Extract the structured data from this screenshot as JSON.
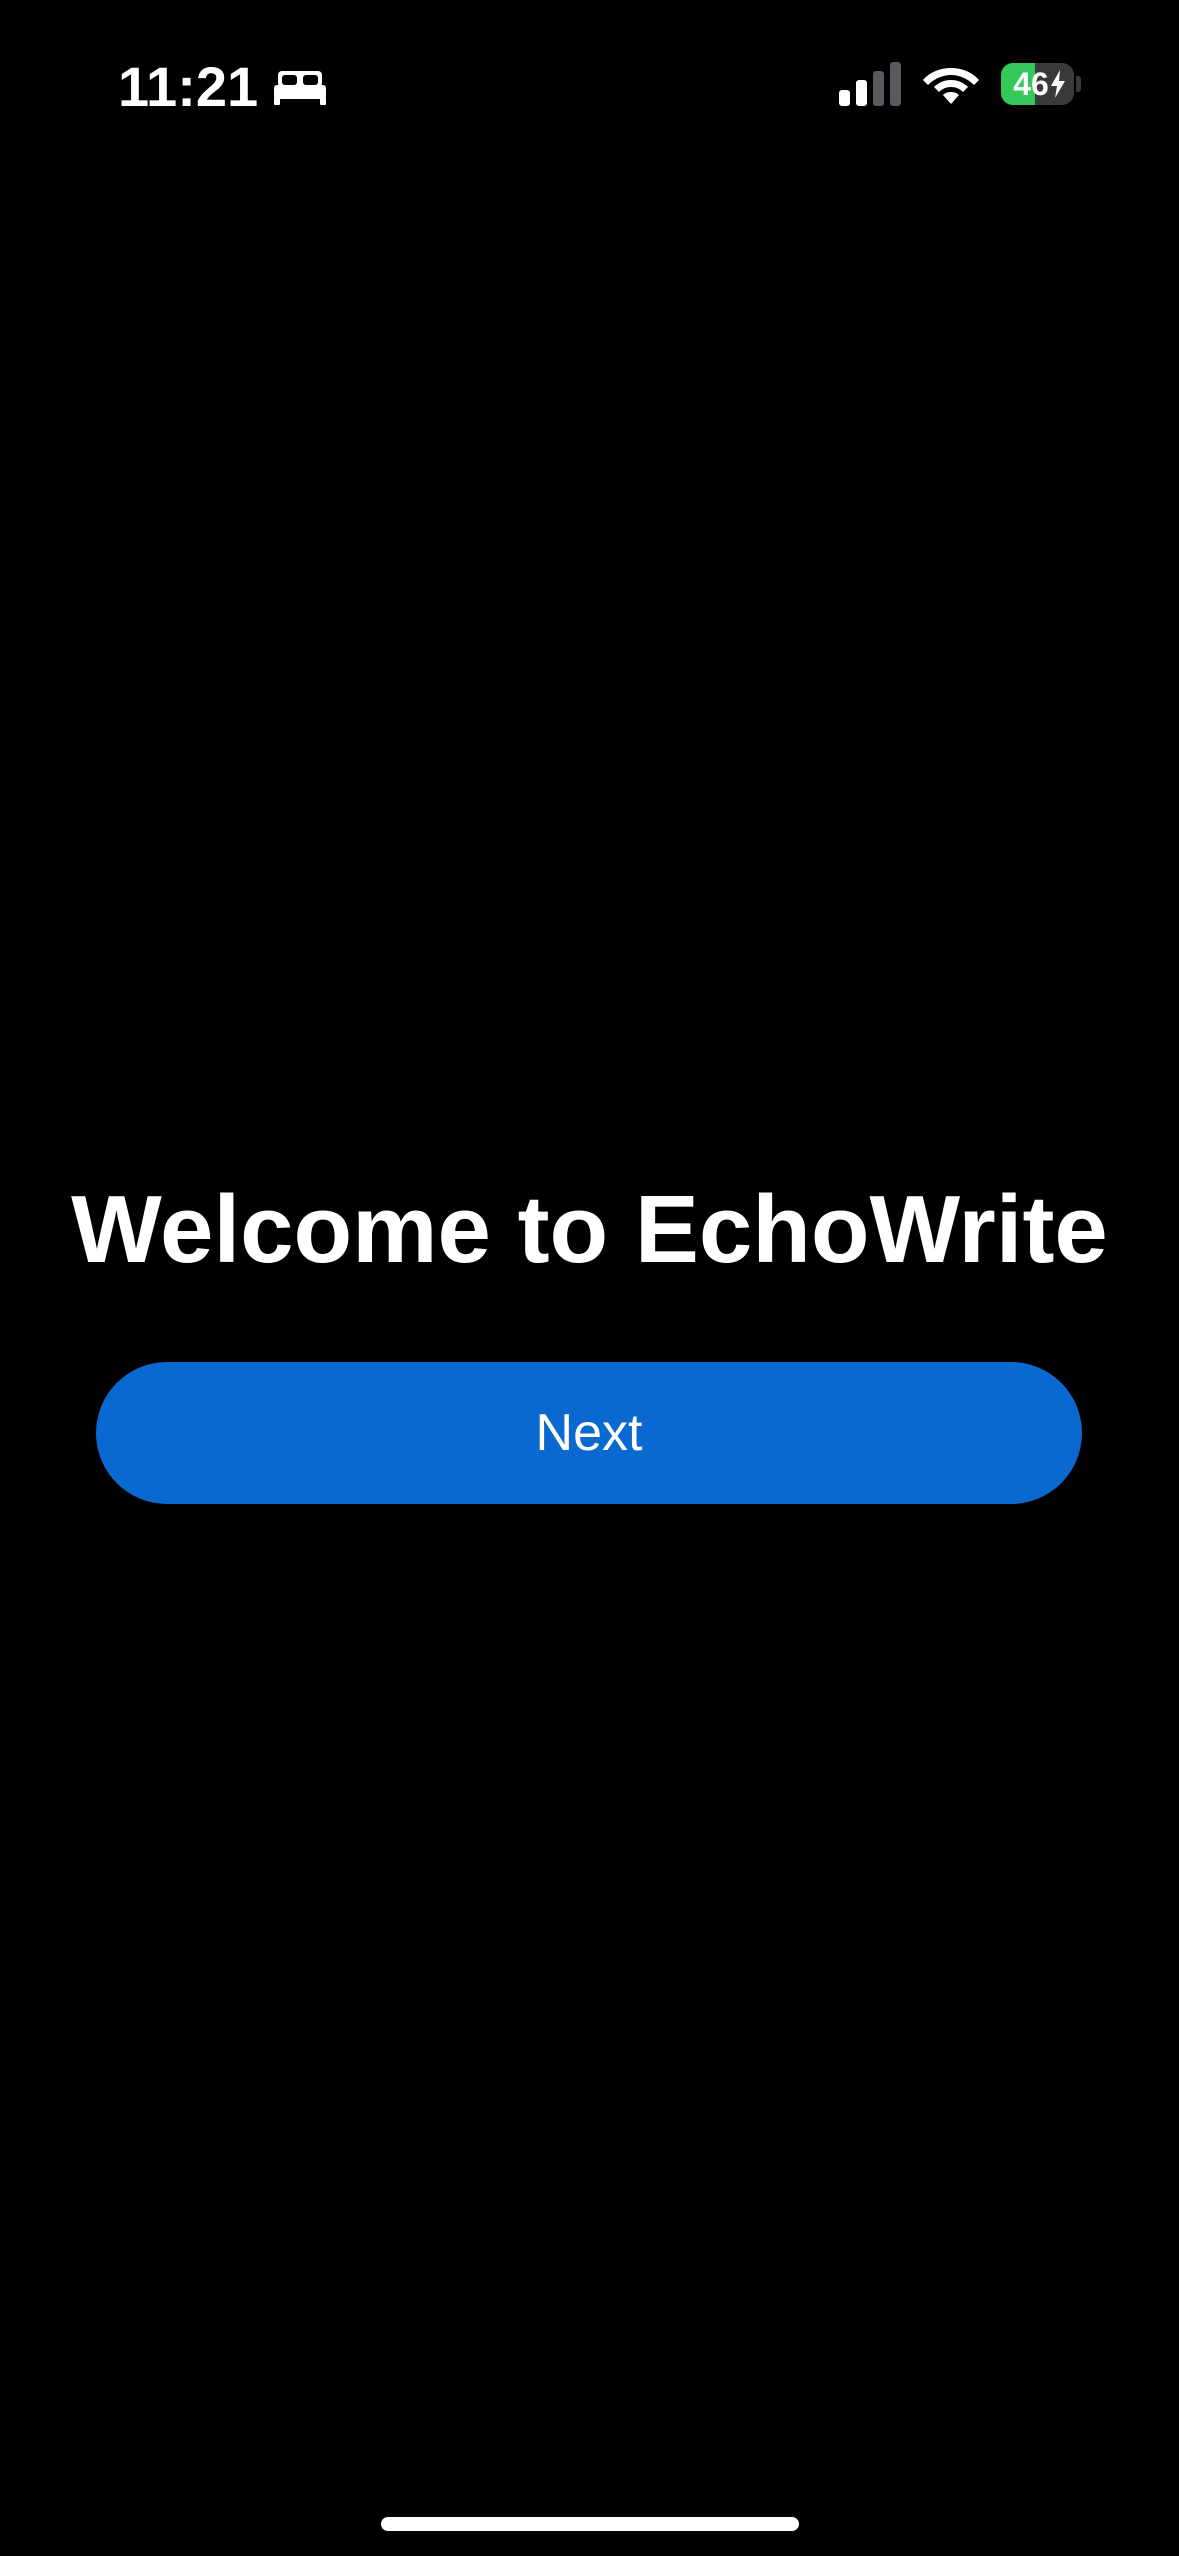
{
  "status_bar": {
    "time": "11:21",
    "focus_icon": "bed-icon",
    "signal_icon": "cellular-signal-icon",
    "wifi_icon": "wifi-icon",
    "battery_level": "46",
    "battery_percent": 46,
    "battery_charging": true
  },
  "main": {
    "title": "Welcome to EchoWrite",
    "next_label": "Next"
  },
  "colors": {
    "background": "#000000",
    "accent": "#0a69d1",
    "battery_fill": "#34c759",
    "text": "#ffffff"
  }
}
